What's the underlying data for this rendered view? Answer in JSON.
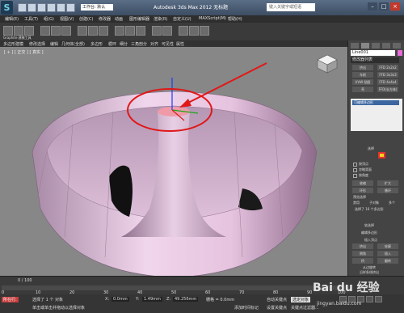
{
  "titlebar": {
    "workspace": "工作台: 默认",
    "title": "Autodesk 3ds Max 2012   无标题",
    "search_placeholder": "键入关键字或短语"
  },
  "menu": {
    "items": [
      "编辑(E)",
      "工具(T)",
      "组(G)",
      "视图(V)",
      "创建(C)",
      "修改器",
      "动画",
      "图形编辑器",
      "渲染(R)",
      "自定义(U)",
      "MAXScript(M)",
      "帮助(H)"
    ]
  },
  "ribbon": {
    "tab_label": "Graphite 建模工具",
    "row2": [
      "多边形建模",
      "修改选择",
      "编辑",
      "几何体(全部)",
      "多边形",
      "循环",
      "细分",
      "三角剖分",
      "对齐",
      "可见性",
      "属性"
    ]
  },
  "viewport": {
    "label": "[ + ] [ 正交 ] [ 真实 ]"
  },
  "panel": {
    "object_name": "Line001",
    "modifier_list": "修改器列表",
    "buttons": [
      "挤出",
      "FFD 2x2x2",
      "车削",
      "FFD 3x3x3",
      "UVW 贴图",
      "FFD 4x4x4",
      "壳",
      "FFD(长方体)"
    ],
    "stack_item": "可编辑多边形",
    "rollout_selection": "选择",
    "opt_vertex": "按顶点",
    "opt_backface": "忽略背面",
    "opt_angle": "按角度",
    "shrink": "收缩",
    "grow": "扩大",
    "ring": "环形",
    "loop": "循环",
    "preview": "预览选择",
    "disabled": "禁用",
    "sub_obj": "子对象",
    "multi": "多个",
    "sel_count": "选择了 16 个多边形",
    "soft_sel": "软选择",
    "edit_poly": "编辑多边形",
    "insert_vertex": "插入顶点",
    "extrude": "挤出",
    "outline": "轮廓",
    "bevel": "倒角",
    "inset": "插入",
    "bridge": "桥",
    "flip": "翻转",
    "hinge": "从边旋转",
    "extrude_spline": "沿样条线挤出",
    "edit_tri": "编辑三角剖分"
  },
  "timeline": {
    "frame": "0 / 100",
    "ticks": [
      "0",
      "10",
      "20",
      "30",
      "40",
      "50",
      "60",
      "70",
      "80",
      "90",
      "100"
    ]
  },
  "status": {
    "mode": "所在行:",
    "selected": "选择了 1 个 对象",
    "hint": "单击或单击并拖动以选择对象",
    "x_label": "X:",
    "x_val": "0.0mm",
    "y_label": "Y:",
    "y_val": "1.49mm",
    "z_label": "Z:",
    "z_val": "49.256mm",
    "grid": "栅格 = 0.0mm",
    "autokey": "自动关键点",
    "autokey_sel": "选定对象",
    "setkey": "设置关键点",
    "keyfilter": "关键点过滤器...",
    "add_tag": "添加时间标记"
  },
  "watermark": {
    "brand": "Bai du 经验",
    "url": "jingyan.baidu.com"
  }
}
